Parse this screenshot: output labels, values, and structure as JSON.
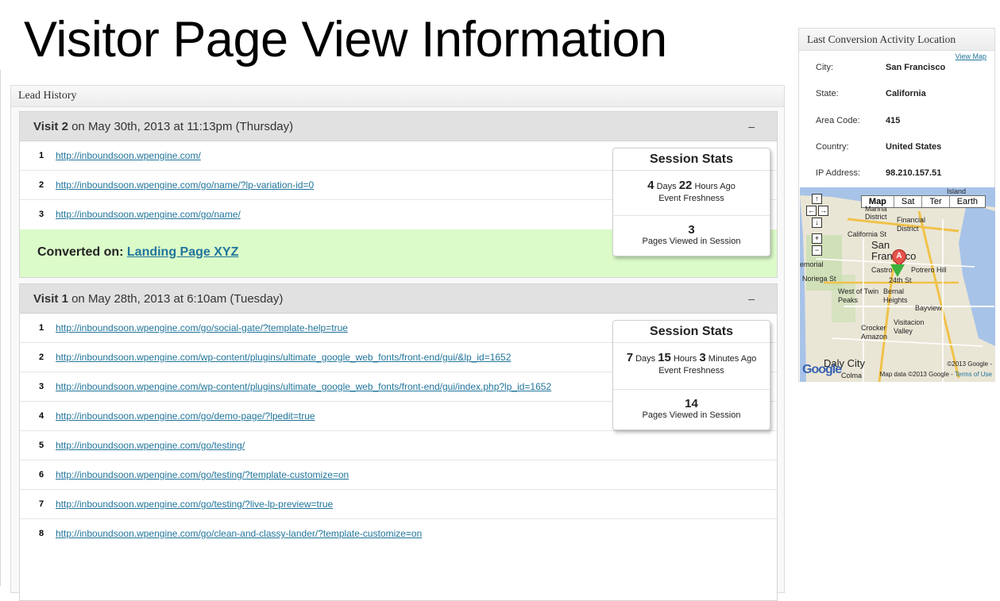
{
  "page_title": "Visitor Page View Information",
  "lead_history": {
    "title": "Lead History",
    "collapse_symbol": "–",
    "visits": [
      {
        "visit_label": "Visit 2",
        "visit_date": " on May 30th, 2013 at 11:13pm (Thursday)",
        "pages": [
          {
            "num": "1",
            "url": "http://inboundsoon.wpengine.com/"
          },
          {
            "num": "2",
            "url": "http://inboundsoon.wpengine.com/go/name/?lp-variation-id=0"
          },
          {
            "num": "3",
            "url": "http://inboundsoon.wpengine.com/go/name/"
          }
        ],
        "converted_label": "Converted on: ",
        "converted_link": "Landing Page XYZ",
        "stats": {
          "title": "Session Stats",
          "days": "4",
          "days_unit": " Days ",
          "hours": "22",
          "hours_unit": " Hours Ago",
          "freshness_label": "Event Freshness",
          "pages_count": "3",
          "pages_label": "Pages Viewed in Session"
        }
      },
      {
        "visit_label": "Visit 1",
        "visit_date": " on May 28th, 2013 at 6:10am (Tuesday)",
        "pages": [
          {
            "num": "1",
            "url": "http://inboundsoon.wpengine.com/go/social-gate/?template-help=true"
          },
          {
            "num": "2",
            "url": "http://inboundsoon.wpengine.com/wp-content/plugins/ultimate_google_web_fonts/front-end/gui/&lp_id=1652"
          },
          {
            "num": "3",
            "url": "http://inboundsoon.wpengine.com/wp-content/plugins/ultimate_google_web_fonts/front-end/gui/index.php?lp_id=1652"
          },
          {
            "num": "4",
            "url": "http://inboundsoon.wpengine.com/go/demo-page/?lpedit=true"
          },
          {
            "num": "5",
            "url": "http://inboundsoon.wpengine.com/go/testing/"
          },
          {
            "num": "6",
            "url": "http://inboundsoon.wpengine.com/go/testing/?template-customize=on"
          },
          {
            "num": "7",
            "url": "http://inboundsoon.wpengine.com/go/testing/?live-lp-preview=true"
          },
          {
            "num": "8",
            "url": "http://inboundsoon.wpengine.com/go/clean-and-classy-lander/?template-customize=on"
          }
        ],
        "stats": {
          "title": "Session Stats",
          "days": "7",
          "days_unit": " Days ",
          "hours": "15",
          "hours_unit": " Hours ",
          "minutes": "3",
          "minutes_unit": " Minutes Ago",
          "freshness_label": "Event Freshness",
          "pages_count": "14",
          "pages_label": "Pages Viewed in Session"
        }
      }
    ]
  },
  "conversion_location": {
    "title": "Last Conversion Activity Location",
    "view_map": "View Map",
    "fields": [
      {
        "label": "City:",
        "value": "San Francisco"
      },
      {
        "label": "State:",
        "value": "California"
      },
      {
        "label": "Area Code:",
        "value": "415"
      },
      {
        "label": "Country:",
        "value": "United States"
      },
      {
        "label": "IP Address:",
        "value": "98.210.157.51"
      }
    ],
    "map": {
      "types": [
        "Map",
        "Sat",
        "Ter",
        "Earth"
      ],
      "labels": [
        "Island",
        "Marina District",
        "Financial District",
        "California St",
        "San Francisco",
        "Castro",
        "Noriega St",
        "West of Twin Peaks",
        "Bernal Heights",
        "Bayview",
        "Visitacion Valley",
        "Crocker Amazon",
        "Daly City",
        "Colma",
        "Potrero Hill",
        "24th St",
        "emorial"
      ],
      "copyright": "©2013 Google -",
      "map_data": "Map data ©2013 Google - ",
      "terms": "Terms of Use",
      "logo": "Google",
      "marker_label": "A"
    }
  }
}
